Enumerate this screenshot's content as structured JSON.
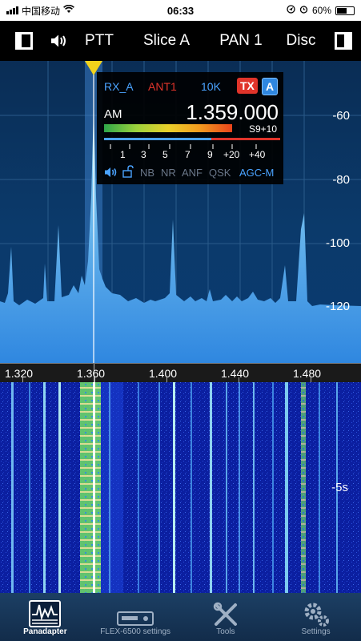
{
  "status_bar": {
    "carrier": "中国移动",
    "time": "06:33",
    "battery": "60%",
    "battery_level": 0.6
  },
  "toolbar": {
    "left_icon": "sidebar-left-icon",
    "speaker_icon": "speaker-icon",
    "ptt": "PTT",
    "slice": "Slice A",
    "pan": "PAN 1",
    "disc": "Disc",
    "right_icon": "sidebar-right-icon"
  },
  "slice_panel": {
    "rx": "RX_A",
    "antenna": "ANT1",
    "filter": "10K",
    "tx_badge": "TX",
    "slice_badge": "A",
    "mode": "AM",
    "frequency": "1.359.000",
    "s_reading": "S9+10",
    "meter_scale": [
      "1",
      "3",
      "5",
      "7",
      "9",
      "+20",
      "+40"
    ],
    "flags": [
      "NB",
      "NR",
      "ANF",
      "QSK",
      "AGC-M"
    ]
  },
  "dbm_labels": [
    "-60",
    "-80",
    "-100",
    "-120"
  ],
  "freq_labels": [
    "1.320",
    "1.360",
    "1.400",
    "1.440",
    "1.480"
  ],
  "waterfall_label": "-5s",
  "colors": {
    "accent_blue": "#2f87e0",
    "tx_red": "#e0342a",
    "marker_yellow": "#f2d31b"
  },
  "bottom_nav": [
    {
      "label": "Panadapter",
      "icon": "panadapter-icon"
    },
    {
      "label": "FLEX-6500 settings",
      "icon": "radio-icon"
    },
    {
      "label": "Tools",
      "icon": "tools-icon"
    },
    {
      "label": "Settings",
      "icon": "gear-icon"
    }
  ]
}
